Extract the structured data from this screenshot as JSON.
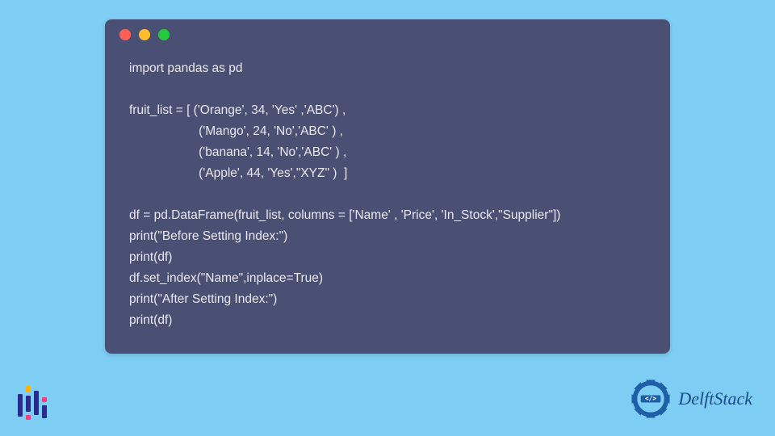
{
  "code": {
    "lines": [
      "import pandas as pd",
      "",
      "fruit_list = [ ('Orange', 34, 'Yes' ,'ABC') ,",
      "                    ('Mango', 24, 'No','ABC' ) ,",
      "                    ('banana', 14, 'No','ABC' ) ,",
      "                    ('Apple', 44, 'Yes',\"XYZ\" )  ]",
      "",
      "df = pd.DataFrame(fruit_list, columns = ['Name' , 'Price', 'In_Stock',\"Supplier\"])",
      "print(\"Before Setting Index:\")",
      "print(df)",
      "df.set_index(\"Name\",inplace=True)",
      "print(\"After Setting Index:\")",
      "print(df)"
    ]
  },
  "titlebar": {
    "dots": [
      "red",
      "yellow",
      "green"
    ]
  },
  "brand": {
    "name": "DelftStack"
  }
}
